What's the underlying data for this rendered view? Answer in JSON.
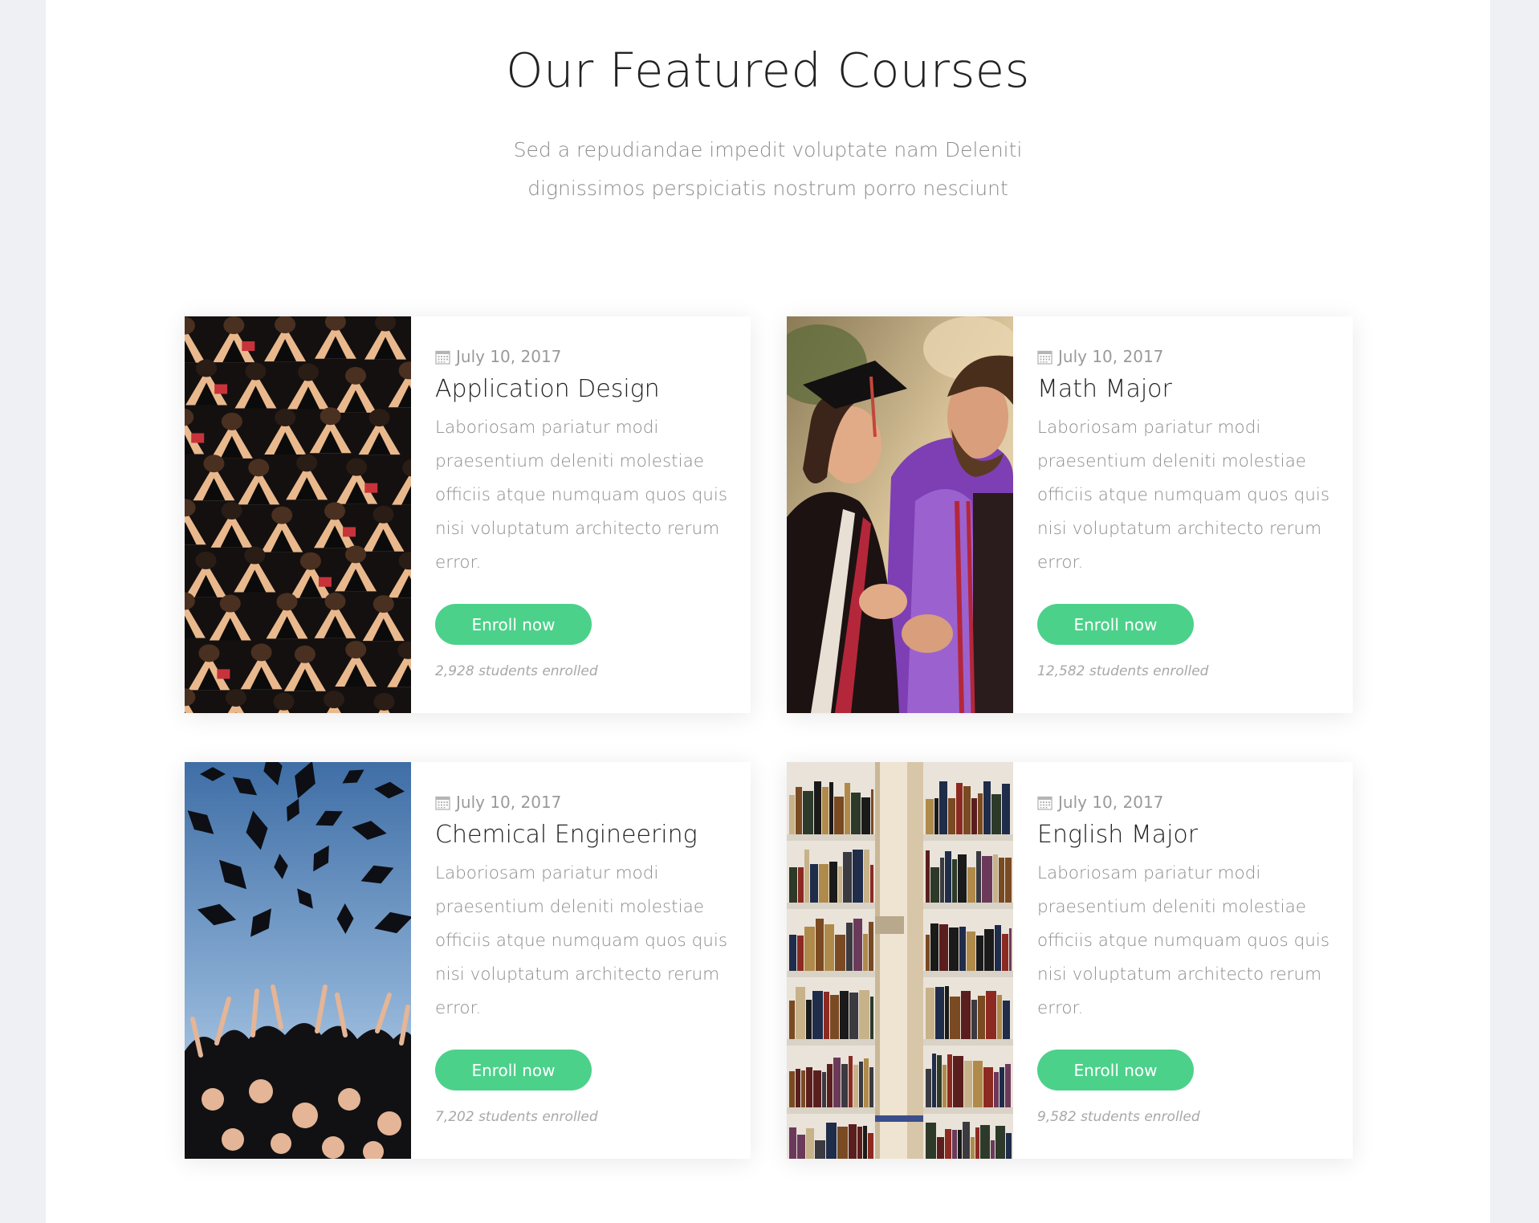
{
  "section": {
    "title": "Our Featured Courses",
    "subtitle_line1": "Sed a repudiandae impedit voluptate nam Deleniti",
    "subtitle_line2": "dignissimos perspiciatis nostrum porro nesciunt"
  },
  "courses": [
    {
      "image": "graduates-crowd-photo",
      "date": "July 10, 2017",
      "title": "Application Design",
      "description": "Laboriosam pariatur modi praesentium deleniti molestiae officiis atque numquam quos quis nisi voluptatum architecto rerum error.",
      "button_label": "Enroll now",
      "enrolled": "2,928 students enrolled"
    },
    {
      "image": "graduate-couple-photo",
      "date": "July 10, 2017",
      "title": "Math Major",
      "description": "Laboriosam pariatur modi praesentium deleniti molestiae officiis atque numquam quos quis nisi voluptatum architecto rerum error.",
      "button_label": "Enroll now",
      "enrolled": "12,582 students enrolled"
    },
    {
      "image": "caps-thrown-photo",
      "date": "July 10, 2017",
      "title": "Chemical Engineering",
      "description": "Laboriosam pariatur modi praesentium deleniti molestiae officiis atque numquam quos quis nisi voluptatum architecto rerum error.",
      "button_label": "Enroll now",
      "enrolled": "7,202 students enrolled"
    },
    {
      "image": "library-shelves-photo",
      "date": "July 10, 2017",
      "title": "English Major",
      "description": "Laboriosam pariatur modi praesentium deleniti molestiae officiis atque numquam quos quis nisi voluptatum architecto rerum error.",
      "button_label": "Enroll now",
      "enrolled": "9,582 students enrolled"
    }
  ],
  "colors": {
    "accent": "#4cd18a",
    "page_background": "#eef0f4",
    "title_text": "#222222",
    "muted_text": "#8c8c8c"
  },
  "icons": {
    "date": "calendar-icon"
  }
}
